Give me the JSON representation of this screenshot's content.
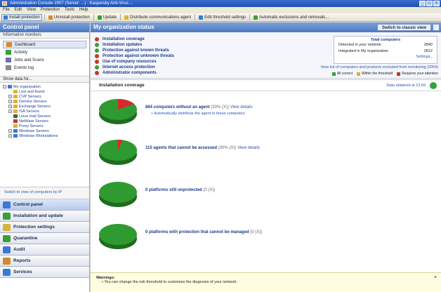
{
  "window": {
    "title": "Administration Console 2007 (Server: ...) - Kaspersky Anti-Virus ..."
  },
  "menu": [
    "File",
    "Edit",
    "View",
    "Protection",
    "Tools",
    "Help"
  ],
  "toolbar": [
    {
      "label": "Install protection",
      "icon": "install-icon",
      "color": "#3a78d8",
      "active": true
    },
    {
      "label": "Uninstall protection",
      "icon": "uninstall-icon",
      "color": "#d28a2c"
    },
    {
      "label": "Update",
      "icon": "update-icon",
      "color": "#3a9e3a"
    },
    {
      "label": "Distribute communications agent",
      "icon": "distribute-icon",
      "color": "#d8b33a"
    },
    {
      "label": "Edit threshold settings",
      "icon": "threshold-icon",
      "color": "#3a78d8"
    },
    {
      "label": "Automatic exclusions and removals...",
      "icon": "exclusions-icon",
      "color": "#3a9e3a"
    }
  ],
  "left": {
    "header": "Control panel",
    "info_label": "Information monitors",
    "monitors": [
      {
        "label": "Dashboard",
        "icon": "dashboard-icon",
        "color": "#d88a2c",
        "selected": true
      },
      {
        "label": "Activity",
        "icon": "activity-icon",
        "color": "#3a9e3a"
      },
      {
        "label": "Jobs and Scans",
        "icon": "jobs-icon",
        "color": "#6f6fb0"
      },
      {
        "label": "Events log",
        "icon": "events-icon",
        "color": "#8a8a8a"
      }
    ],
    "show_data_label": "Show data for...",
    "tree": [
      {
        "label": "My organization",
        "depth": 0,
        "exp": "-",
        "color": "#3a78d8"
      },
      {
        "label": "Lost and found",
        "depth": 1,
        "exp": "",
        "color": "#d8b33a"
      },
      {
        "label": "CVP Servers",
        "depth": 1,
        "exp": "+",
        "color": "#d8b33a"
      },
      {
        "label": "Domino Servers",
        "depth": 1,
        "exp": "+",
        "color": "#d8b33a"
      },
      {
        "label": "Exchange Servers",
        "depth": 1,
        "exp": "+",
        "color": "#d8b33a"
      },
      {
        "label": "ISA Servers",
        "depth": 1,
        "exp": "+",
        "color": "#d8b33a"
      },
      {
        "label": "Linux mail Servers",
        "depth": 1,
        "exp": "",
        "color": "#555555"
      },
      {
        "label": "NetWare Servers",
        "depth": 1,
        "exp": "",
        "color": "#c0392b"
      },
      {
        "label": "Proxy Servers",
        "depth": 1,
        "exp": "",
        "color": "#d8b33a"
      },
      {
        "label": "Windows Servers",
        "depth": 1,
        "exp": "+",
        "color": "#3a78d8"
      },
      {
        "label": "Windows Workstations",
        "depth": 1,
        "exp": "+",
        "color": "#3a78d8"
      }
    ],
    "switch_link": "Switch to view of computers by IP",
    "nav": [
      {
        "label": "Control panel",
        "icon": "control-panel-icon",
        "color": "#3a78d8",
        "active": true
      },
      {
        "label": "Installation and update",
        "icon": "installation-icon",
        "color": "#3a9e3a"
      },
      {
        "label": "Protection settings",
        "icon": "protection-icon",
        "color": "#d8b33a"
      },
      {
        "label": "Quarantine",
        "icon": "quarantine-icon",
        "color": "#3a9e3a"
      },
      {
        "label": "Audit",
        "icon": "audit-icon",
        "color": "#3a78d8"
      },
      {
        "label": "Reports",
        "icon": "reports-icon",
        "color": "#d28a2c"
      },
      {
        "label": "Services",
        "icon": "services-icon",
        "color": "#3a78d8"
      }
    ]
  },
  "right": {
    "header": "My organization status",
    "classic_button": "Switch to classic view",
    "status_items": [
      {
        "label": "Installation coverage",
        "status": "error",
        "color": "#c0392b"
      },
      {
        "label": "Installation updates",
        "status": "ok",
        "color": "#3a9e3a"
      },
      {
        "label": "Protection against known threats",
        "status": "ok",
        "color": "#3a9e3a"
      },
      {
        "label": "Protection against unknown threats",
        "status": "error",
        "color": "#c0392b"
      },
      {
        "label": "Use of company resources",
        "status": "error",
        "color": "#c0392b"
      },
      {
        "label": "Internet access protection",
        "status": "ok",
        "color": "#3a9e3a"
      },
      {
        "label": "Administrator components",
        "status": "error",
        "color": "#c0392b"
      }
    ],
    "total": {
      "title": "Total computers",
      "detected_label": "Detected in your network",
      "detected_value": "2840",
      "integrated_label": "Integrated in My organization",
      "integrated_value": "2812",
      "settings_link": "Settings..."
    },
    "view_list_link": "View list of computers and products excluded from monitoring (2004)",
    "legend": [
      {
        "label": "All correct",
        "color": "#3a9e3a"
      },
      {
        "label": "Within the threshold",
        "color": "#d8b33a"
      },
      {
        "label": "Requires your attention",
        "color": "#c0392b"
      }
    ],
    "coverage": {
      "title": "Installation coverage",
      "date": "Data obtained at 13:59",
      "items": [
        {
          "main": "864 computers without an agent",
          "detail": "(30% (X))",
          "link": "View details",
          "sub": "Automatically distribute the agent to these computers",
          "fraction": 0.16
        },
        {
          "main": "115 agents that cannot be accessed",
          "detail": "(30% (X))",
          "link": "View details",
          "sub": "",
          "fraction": 0.04
        },
        {
          "main": "0 platforms still unprotected",
          "detail": "(0 (X))",
          "link": "",
          "sub": "",
          "fraction": 0
        },
        {
          "main": "0 platforms with protection that cannot be managed",
          "detail": "(0 (X))",
          "link": "",
          "sub": "",
          "fraction": 0
        }
      ]
    },
    "warnings": {
      "title": "Warnings:",
      "text": "You can change the risk threshold to customize the diagnosis of your network."
    }
  }
}
